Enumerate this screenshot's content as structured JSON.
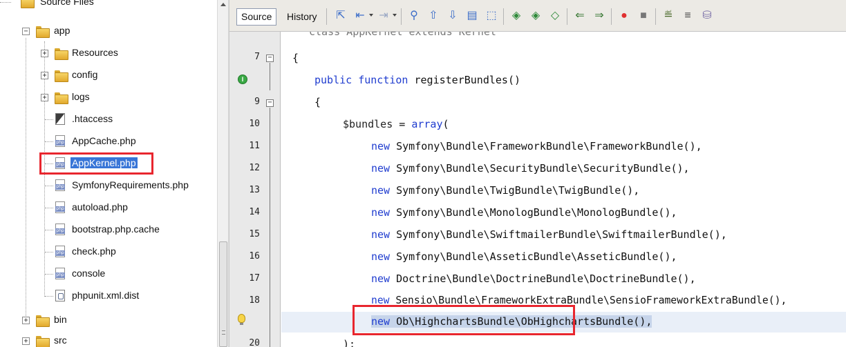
{
  "tree": {
    "root_label": "Source Files",
    "items": [
      {
        "label": "app",
        "type": "folder",
        "level": 1,
        "expander": "−"
      },
      {
        "label": "Resources",
        "type": "folder",
        "level": 2,
        "expander": "+"
      },
      {
        "label": "config",
        "type": "folder",
        "level": 2,
        "expander": "+"
      },
      {
        "label": "logs",
        "type": "folder",
        "level": 2,
        "expander": "+"
      },
      {
        "label": ".htaccess",
        "type": "htaccess",
        "level": 2
      },
      {
        "label": "AppCache.php",
        "type": "php",
        "level": 2
      },
      {
        "label": "AppKernel.php",
        "type": "php",
        "level": 2,
        "selected": true
      },
      {
        "label": "SymfonyRequirements.php",
        "type": "php",
        "level": 2
      },
      {
        "label": "autoload.php",
        "type": "php",
        "level": 2
      },
      {
        "label": "bootstrap.php.cache",
        "type": "php",
        "level": 2
      },
      {
        "label": "check.php",
        "type": "php",
        "level": 2
      },
      {
        "label": "console",
        "type": "php",
        "level": 2
      },
      {
        "label": "phpunit.xml.dist",
        "type": "file",
        "level": 2
      },
      {
        "label": "bin",
        "type": "folder",
        "level": 1,
        "expander": "+"
      },
      {
        "label": "src",
        "type": "folder",
        "level": 1,
        "expander": "+"
      }
    ],
    "php_icon_text": "php"
  },
  "editor": {
    "tabs": {
      "source": "Source",
      "history": "History"
    },
    "line_numbers": [
      "7",
      "",
      "9",
      "10",
      "11",
      "12",
      "13",
      "14",
      "15",
      "16",
      "17",
      "18",
      "",
      "20"
    ],
    "code": {
      "l6": "class AppKernel extends Kernel",
      "l7": "{",
      "l8_kw": "public function",
      "l8_fn": " registerBundles()",
      "l9": "{",
      "l10_var": "$bundles",
      "l10_rest": " = ",
      "l10_kw": "array",
      "l10_end": "(",
      "new_kw": "new",
      "b11": " Symfony\\Bundle\\FrameworkBundle\\FrameworkBundle(),",
      "b12": " Symfony\\Bundle\\SecurityBundle\\SecurityBundle(),",
      "b13": " Symfony\\Bundle\\TwigBundle\\TwigBundle(),",
      "b14": " Symfony\\Bundle\\MonologBundle\\MonologBundle(),",
      "b15": " Symfony\\Bundle\\SwiftmailerBundle\\SwiftmailerBundle(),",
      "b16": " Symfony\\Bundle\\AsseticBundle\\AsseticBundle(),",
      "b17": " Doctrine\\Bundle\\DoctrineBundle\\DoctrineBundle(),",
      "b18": " Sensio\\Bundle\\FrameworkExtraBundle\\SensioFrameworkExtraBundle(),",
      "b19": " Ob\\HighchartsBundle\\ObHighchartsBundle(),",
      "l20": ");"
    },
    "gutter_marks": {
      "line8": "implements-icon",
      "line19": "hint-bulb-icon"
    },
    "fold_minus": "−"
  },
  "colors": {
    "highlight_box": "#e8262e",
    "selection": "#3875d7",
    "keyword": "#1f3ccf"
  }
}
